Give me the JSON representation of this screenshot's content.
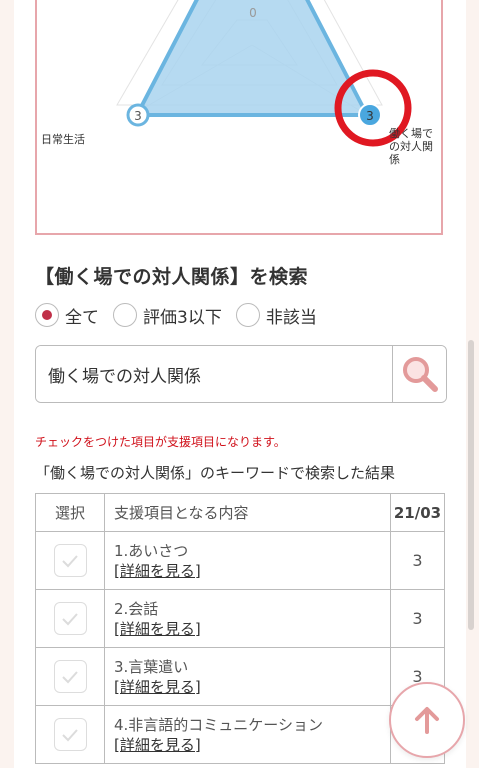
{
  "chart_data": {
    "type": "radar",
    "axes": [
      "",
      "働く場での対人関係",
      "日常生活"
    ],
    "values": [
      3,
      3,
      3
    ],
    "ticks": [
      "0"
    ],
    "point_labels": [
      "3",
      "3"
    ],
    "colors": {
      "fill": "#a9d3ef",
      "stroke": "#6bb5e0",
      "highlight": "#e01822"
    }
  },
  "chart": {
    "tick_zero": "0",
    "left_value": "3",
    "right_value": "3",
    "left_axis_label": "日常生活",
    "right_axis_label": "働く場での対人関係"
  },
  "search": {
    "title": "【働く場での対人関係】を検索",
    "radio_options": [
      {
        "label": "全て",
        "selected": true
      },
      {
        "label": "評価3以下",
        "selected": false
      },
      {
        "label": "非該当",
        "selected": false
      }
    ],
    "input_value": "働く場での対人関係",
    "button_icon": "search-icon"
  },
  "note": "チェックをつけた項目が支援項目になります。",
  "result_caption": "「働く場での対人関係」のキーワードで検索した結果",
  "table": {
    "headers": [
      "選択",
      "支援項目となる内容",
      "21/03"
    ],
    "rows": [
      {
        "title": "1.あいさつ",
        "link": "[詳細を見る]",
        "value": "3"
      },
      {
        "title": "2.会話",
        "link": "[詳細を見る]",
        "value": "3"
      },
      {
        "title": "3.言葉遣い",
        "link": "[詳細を見る]",
        "value": "3"
      },
      {
        "title": "4.非言語的コミュニケーション",
        "link": "[詳細を見る]",
        "value": ""
      }
    ]
  },
  "fab_icon": "arrow-up-icon",
  "colors": {
    "accent": "#c03048",
    "card_border": "#e7a6ab",
    "note_red": "#d0101a"
  }
}
